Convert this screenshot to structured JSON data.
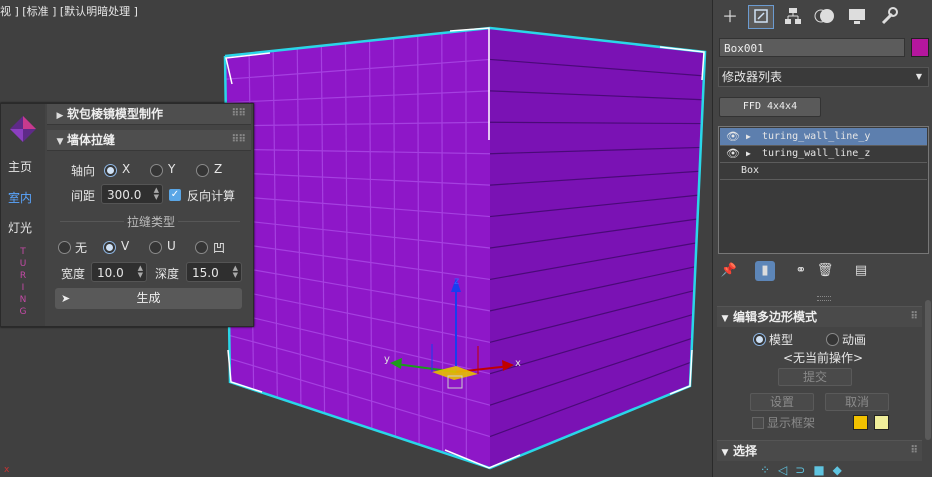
{
  "viewport": {
    "label": "视 ] [标准 ] [默认明暗处理 ]",
    "axis_x": "x",
    "axis_y": "y",
    "axis_z": "z",
    "object_color": "#8e17c8",
    "selection_color": "#2ad6e8"
  },
  "plugin": {
    "sidebar": {
      "home": "主页",
      "indoor": "室内",
      "light": "灯光",
      "brand_letters": [
        "T",
        "U",
        "R",
        "I",
        "N",
        "G"
      ]
    },
    "section1_title": "软包棱镜模型制作",
    "section2_title": "墙体拉缝",
    "axis_label": "轴向",
    "axis_options": [
      "X",
      "Y",
      "Z"
    ],
    "axis_selected": "X",
    "spacing_label": "间距",
    "spacing_value": "300.0",
    "reverse_calc_label": "反向计算",
    "reverse_calc_checked": true,
    "seam_type_label": "拉缝类型",
    "seam_options": [
      "无",
      "V",
      "U",
      "凹"
    ],
    "seam_selected": "V",
    "width_label": "宽度",
    "width_value": "10.0",
    "depth_label": "深度",
    "depth_value": "15.0",
    "generate_label": "生成"
  },
  "command_panel": {
    "tabs": [
      "create-icon",
      "modify-icon",
      "hierarchy-icon",
      "motion-icon",
      "display-icon",
      "utilities-icon"
    ],
    "active_tab": "modify-icon",
    "object_name": "Box001",
    "object_color": "#b5169e",
    "modifier_list": "修改器列表",
    "ffd_button": "FFD 4x4x4",
    "stack": [
      {
        "name": "turing_wall_line_y",
        "selected": true,
        "expandable": true
      },
      {
        "name": "turing_wall_line_z",
        "selected": false,
        "expandable": true
      },
      {
        "name": "Box",
        "selected": false,
        "expandable": false
      }
    ],
    "edit_poly": {
      "title": "编辑多边形模式",
      "mode_model": "模型",
      "mode_anim": "动画",
      "mode_selected": "模型",
      "no_op": "<无当前操作>",
      "commit": "提交",
      "settings": "设置",
      "cancel": "取消",
      "show_cage": "显示框架",
      "cage_color1": "#f2c200",
      "cage_color2": "#f0ee9a"
    },
    "selection_title": "选择"
  }
}
